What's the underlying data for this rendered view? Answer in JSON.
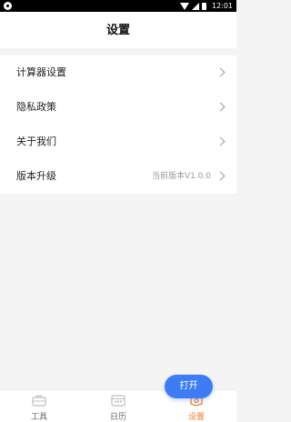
{
  "status_bar": {
    "time": "12:01"
  },
  "header": {
    "title": "设置"
  },
  "menu": {
    "items": [
      {
        "label": "计算器设置"
      },
      {
        "label": "隐私政策"
      },
      {
        "label": "关于我们"
      },
      {
        "label": "版本升级",
        "value": "当前版本V1.0.0"
      }
    ]
  },
  "floating_button": {
    "label": "打开"
  },
  "tabbar": {
    "tabs": [
      {
        "label": "工具",
        "icon": "toolbox-icon"
      },
      {
        "label": "日历",
        "icon": "calendar-icon"
      },
      {
        "label": "设置",
        "icon": "settings-icon",
        "active": true
      }
    ]
  },
  "colors": {
    "accent": "#f07d2a",
    "button": "#3d7cf4"
  }
}
